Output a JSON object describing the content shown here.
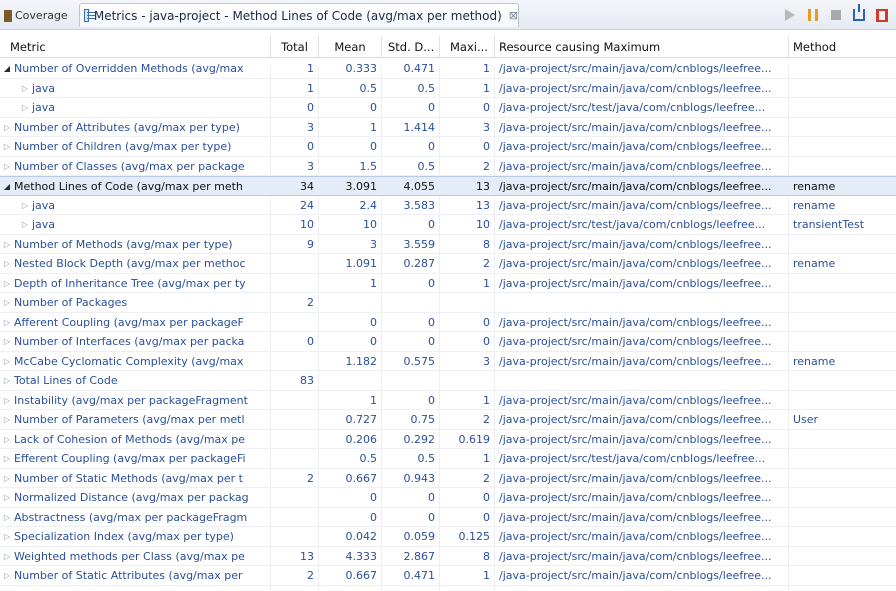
{
  "tabs": {
    "inactive_label": "Coverage",
    "active_title": "Metrics - java-project - Method Lines of Code (avg/max per method)",
    "close_glyph": "⊠"
  },
  "toolbar": {
    "buttons": [
      "run-icon",
      "pause-icon",
      "stop-icon",
      "export-icon",
      "layout-icon"
    ]
  },
  "table": {
    "columns": {
      "metric": "Metric",
      "total": "Total",
      "mean": "Mean",
      "std": "Std. D...",
      "maxi": "Maxi...",
      "resource": "Resource causing Maximum",
      "method": "Method"
    },
    "rows": [
      {
        "level": 0,
        "expanded": true,
        "metric": "Number of Overridden Methods (avg/max",
        "total": "1",
        "mean": "0.333",
        "std": "0.471",
        "maxi": "1",
        "resource": "/java-project/src/main/java/com/cnblogs/leefree...",
        "method": ""
      },
      {
        "level": 1,
        "expanded": false,
        "metric": "java",
        "total": "1",
        "mean": "0.5",
        "std": "0.5",
        "maxi": "1",
        "resource": "/java-project/src/main/java/com/cnblogs/leefree...",
        "method": ""
      },
      {
        "level": 1,
        "expanded": false,
        "metric": "java",
        "total": "0",
        "mean": "0",
        "std": "0",
        "maxi": "0",
        "resource": "/java-project/src/test/java/com/cnblogs/leefree...",
        "method": ""
      },
      {
        "level": 0,
        "expanded": false,
        "metric": "Number of Attributes (avg/max per type)",
        "total": "3",
        "mean": "1",
        "std": "1.414",
        "maxi": "3",
        "resource": "/java-project/src/main/java/com/cnblogs/leefree...",
        "method": ""
      },
      {
        "level": 0,
        "expanded": false,
        "metric": "Number of Children (avg/max per type)",
        "total": "0",
        "mean": "0",
        "std": "0",
        "maxi": "0",
        "resource": "/java-project/src/main/java/com/cnblogs/leefree...",
        "method": ""
      },
      {
        "level": 0,
        "expanded": false,
        "metric": "Number of Classes (avg/max per package",
        "total": "3",
        "mean": "1.5",
        "std": "0.5",
        "maxi": "2",
        "resource": "/java-project/src/main/java/com/cnblogs/leefree...",
        "method": ""
      },
      {
        "level": 0,
        "expanded": true,
        "selected": true,
        "metric": "Method Lines of Code (avg/max per meth",
        "total": "34",
        "mean": "3.091",
        "std": "4.055",
        "maxi": "13",
        "resource": "/java-project/src/main/java/com/cnblogs/leefree...",
        "method": "rename"
      },
      {
        "level": 1,
        "expanded": false,
        "metric": "java",
        "total": "24",
        "mean": "2.4",
        "std": "3.583",
        "maxi": "13",
        "resource": "/java-project/src/main/java/com/cnblogs/leefree...",
        "method": "rename"
      },
      {
        "level": 1,
        "expanded": false,
        "metric": "java",
        "total": "10",
        "mean": "10",
        "std": "0",
        "maxi": "10",
        "resource": "/java-project/src/test/java/com/cnblogs/leefree...",
        "method": "transientTest"
      },
      {
        "level": 0,
        "expanded": false,
        "metric": "Number of Methods (avg/max per type)",
        "total": "9",
        "mean": "3",
        "std": "3.559",
        "maxi": "8",
        "resource": "/java-project/src/main/java/com/cnblogs/leefree...",
        "method": ""
      },
      {
        "level": 0,
        "expanded": false,
        "metric": "Nested Block Depth (avg/max per methoc",
        "total": "",
        "mean": "1.091",
        "std": "0.287",
        "maxi": "2",
        "resource": "/java-project/src/main/java/com/cnblogs/leefree...",
        "method": "rename"
      },
      {
        "level": 0,
        "expanded": false,
        "metric": "Depth of Inheritance Tree (avg/max per ty",
        "total": "",
        "mean": "1",
        "std": "0",
        "maxi": "1",
        "resource": "/java-project/src/main/java/com/cnblogs/leefree...",
        "method": ""
      },
      {
        "level": 0,
        "expanded": false,
        "metric": "Number of Packages",
        "total": "2",
        "mean": "",
        "std": "",
        "maxi": "",
        "resource": "",
        "method": ""
      },
      {
        "level": 0,
        "expanded": false,
        "metric": "Afferent Coupling (avg/max per packageF",
        "total": "",
        "mean": "0",
        "std": "0",
        "maxi": "0",
        "resource": "/java-project/src/main/java/com/cnblogs/leefree...",
        "method": ""
      },
      {
        "level": 0,
        "expanded": false,
        "metric": "Number of Interfaces (avg/max per packa",
        "total": "0",
        "mean": "0",
        "std": "0",
        "maxi": "0",
        "resource": "/java-project/src/main/java/com/cnblogs/leefree...",
        "method": ""
      },
      {
        "level": 0,
        "expanded": false,
        "metric": "McCabe Cyclomatic Complexity (avg/max",
        "total": "",
        "mean": "1.182",
        "std": "0.575",
        "maxi": "3",
        "resource": "/java-project/src/main/java/com/cnblogs/leefree...",
        "method": "rename"
      },
      {
        "level": 0,
        "expanded": false,
        "metric": "Total Lines of Code",
        "total": "83",
        "mean": "",
        "std": "",
        "maxi": "",
        "resource": "",
        "method": ""
      },
      {
        "level": 0,
        "expanded": false,
        "metric": "Instability (avg/max per packageFragment",
        "total": "",
        "mean": "1",
        "std": "0",
        "maxi": "1",
        "resource": "/java-project/src/main/java/com/cnblogs/leefree...",
        "method": ""
      },
      {
        "level": 0,
        "expanded": false,
        "metric": "Number of Parameters (avg/max per metl",
        "total": "",
        "mean": "0.727",
        "std": "0.75",
        "maxi": "2",
        "resource": "/java-project/src/main/java/com/cnblogs/leefree...",
        "method": "User"
      },
      {
        "level": 0,
        "expanded": false,
        "metric": "Lack of Cohesion of Methods (avg/max pe",
        "total": "",
        "mean": "0.206",
        "std": "0.292",
        "maxi": "0.619",
        "resource": "/java-project/src/main/java/com/cnblogs/leefree...",
        "method": ""
      },
      {
        "level": 0,
        "expanded": false,
        "metric": "Efferent Coupling (avg/max per packageFi",
        "total": "",
        "mean": "0.5",
        "std": "0.5",
        "maxi": "1",
        "resource": "/java-project/src/test/java/com/cnblogs/leefree...",
        "method": ""
      },
      {
        "level": 0,
        "expanded": false,
        "metric": "Number of Static Methods (avg/max per t",
        "total": "2",
        "mean": "0.667",
        "std": "0.943",
        "maxi": "2",
        "resource": "/java-project/src/main/java/com/cnblogs/leefree...",
        "method": ""
      },
      {
        "level": 0,
        "expanded": false,
        "metric": "Normalized Distance (avg/max per packag",
        "total": "",
        "mean": "0",
        "std": "0",
        "maxi": "0",
        "resource": "/java-project/src/main/java/com/cnblogs/leefree...",
        "method": ""
      },
      {
        "level": 0,
        "expanded": false,
        "metric": "Abstractness (avg/max per packageFragm",
        "total": "",
        "mean": "0",
        "std": "0",
        "maxi": "0",
        "resource": "/java-project/src/main/java/com/cnblogs/leefree...",
        "method": ""
      },
      {
        "level": 0,
        "expanded": false,
        "metric": "Specialization Index (avg/max per type)",
        "total": "",
        "mean": "0.042",
        "std": "0.059",
        "maxi": "0.125",
        "resource": "/java-project/src/main/java/com/cnblogs/leefree...",
        "method": ""
      },
      {
        "level": 0,
        "expanded": false,
        "metric": "Weighted methods per Class (avg/max pe",
        "total": "13",
        "mean": "4.333",
        "std": "2.867",
        "maxi": "8",
        "resource": "/java-project/src/main/java/com/cnblogs/leefree...",
        "method": ""
      },
      {
        "level": 0,
        "expanded": false,
        "metric": "Number of Static Attributes (avg/max per",
        "total": "2",
        "mean": "0.667",
        "std": "0.471",
        "maxi": "1",
        "resource": "/java-project/src/main/java/com/cnblogs/leefree...",
        "method": ""
      }
    ]
  }
}
